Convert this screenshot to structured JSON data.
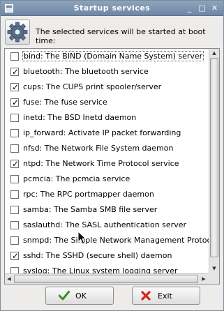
{
  "window": {
    "title": "Startup services",
    "minimize_glyph": "_",
    "maximize_glyph": "□",
    "close_glyph": "✕"
  },
  "header": {
    "icon": "gear-icon",
    "text": "The selected services will be started at boot time:"
  },
  "services": [
    {
      "label": "bind: The BIND (Domain Name System) server",
      "checked": false
    },
    {
      "label": "bluetooth: The bluetooth service",
      "checked": true
    },
    {
      "label": "cups: The CUPS print spooler/server",
      "checked": true
    },
    {
      "label": "fuse: The fuse service",
      "checked": true
    },
    {
      "label": "inetd: The BSD Inetd daemon",
      "checked": false
    },
    {
      "label": "ip_forward: Activate IP packet forwarding",
      "checked": false
    },
    {
      "label": "nfsd: The Network File System daemon",
      "checked": false
    },
    {
      "label": "ntpd: The Network Time Protocol service",
      "checked": true
    },
    {
      "label": "pcmcia: The pcmcia service",
      "checked": false
    },
    {
      "label": "rpc: The RPC portmapper daemon",
      "checked": false
    },
    {
      "label": "samba: The Samba SMB file server",
      "checked": false
    },
    {
      "label": "saslauthd: The SASL authentication server",
      "checked": false
    },
    {
      "label": "snmpd: The Simple Network Management Protocol",
      "checked": false
    },
    {
      "label": "sshd: The SSHD (secure shell) daemon",
      "checked": true
    },
    {
      "label": "syslog: The Linux system logging server",
      "checked": false
    }
  ],
  "buttons": {
    "ok_label": "OK",
    "exit_label": "Exit"
  },
  "colors": {
    "titlebar": "#7891ad",
    "ok_check": "#3c8c2a",
    "exit_x": "#d0271d"
  }
}
